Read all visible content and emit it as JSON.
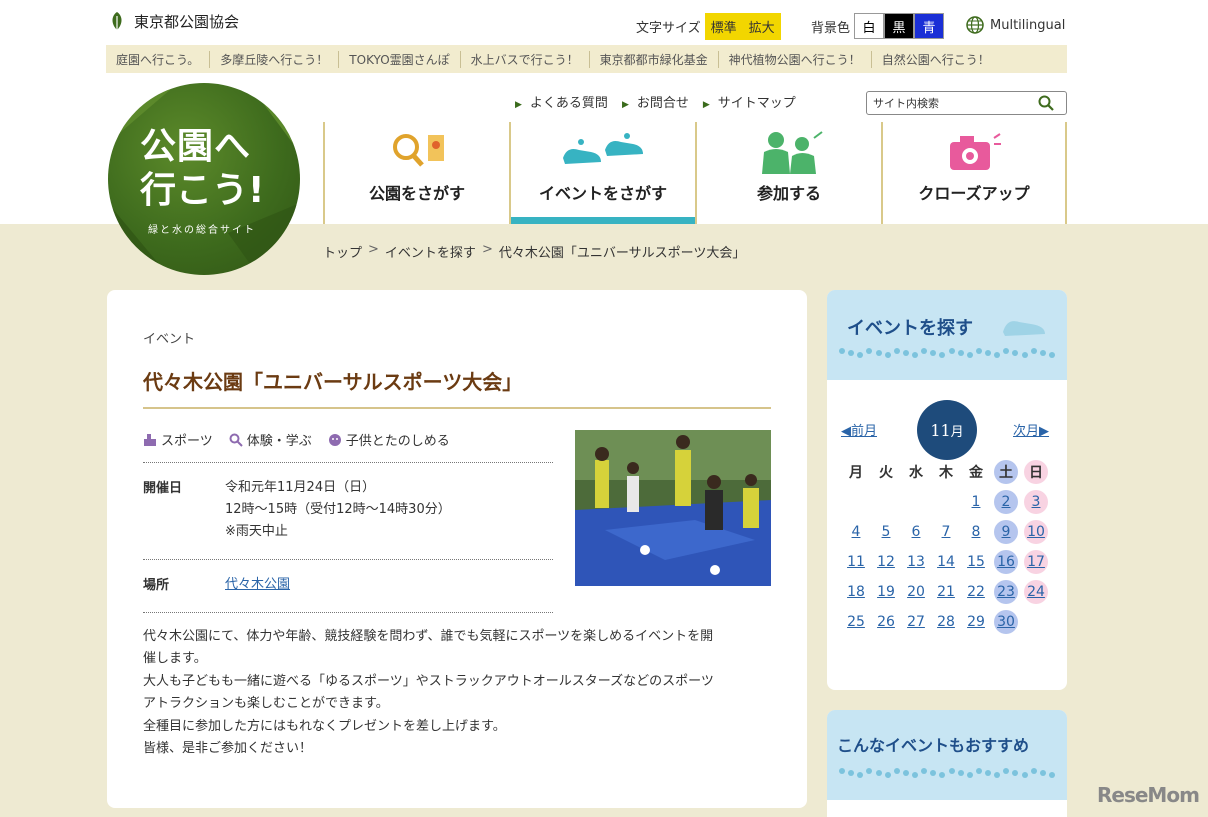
{
  "header": {
    "org_name": "東京都公園協会",
    "text_size_label": "文字サイズ",
    "text_size_options": [
      "標準",
      "拡大"
    ],
    "bg_color_label": "背景色",
    "bg_color_options": [
      "白",
      "黒",
      "青"
    ],
    "multilingual": "Multilingual",
    "subnav": [
      "庭園へ行こう。",
      "多摩丘陵へ行こう！",
      "TOKYO霊園さんぽ",
      "水上バスで行こう！",
      "東京都都市緑化基金",
      "神代植物公園へ行こう！",
      "自然公園へ行こう！"
    ],
    "logo": {
      "line1": "公園へ",
      "line2": "行こう!",
      "tagline": "緑と水の総合サイト"
    },
    "util_links": [
      "よくある質問",
      "お問合せ",
      "サイトマップ"
    ],
    "search_placeholder": "サイト内検索",
    "mainnav": [
      "公園をさがす",
      "イベントをさがす",
      "参加する",
      "クローズアップ"
    ]
  },
  "breadcrumb": [
    "トップ",
    "イベントを探す",
    "代々木公園「ユニバーサルスポーツ大会」"
  ],
  "breadcrumb_sep": ">",
  "event": {
    "category": "イベント",
    "title": "代々木公園「ユニバーサルスポーツ大会」",
    "tags": [
      "スポーツ",
      "体験・学ぶ",
      "子供とたのしめる"
    ],
    "date_label": "開催日",
    "date_lines": [
      "令和元年11月24日（日）",
      "12時～15時（受付12時～14時30分）",
      "※雨天中止"
    ],
    "place_label": "場所",
    "place": "代々木公園",
    "description": [
      "代々木公園にて、体力や年齢、競技経験を問わず、誰でも気軽にスポーツを楽しめるイベントを開",
      "催します。",
      "大人も子どもも一緒に遊べる「ゆるスポーツ」やストラックアウトオールスターズなどのスポーツ",
      "アトラクションも楽しむことができます。",
      "全種目に参加した方にはもれなくプレゼントを差し上げます。",
      "皆様、是非ご参加ください！"
    ]
  },
  "sidebar": {
    "find_title": "イベントを探す",
    "prev": "前月",
    "next": "次月",
    "month_num": "11",
    "month_suffix": "月",
    "weekdays": [
      "月",
      "火",
      "水",
      "木",
      "金",
      "土",
      "日"
    ],
    "days": [
      "",
      "",
      "",
      "",
      "1",
      "2",
      "3",
      "4",
      "5",
      "6",
      "7",
      "8",
      "9",
      "10",
      "11",
      "12",
      "13",
      "14",
      "15",
      "16",
      "17",
      "18",
      "19",
      "20",
      "21",
      "22",
      "23",
      "24",
      "25",
      "26",
      "27",
      "28",
      "29",
      "30",
      ""
    ],
    "recommend_title": "こんなイベントもおすすめ"
  },
  "watermark": "ReseMom",
  "colors": {
    "green": "#3e6b1d",
    "cream": "#eeead2",
    "accent": "#37b3c2",
    "title_brown": "#6b3b12",
    "link": "#2a64a8"
  }
}
